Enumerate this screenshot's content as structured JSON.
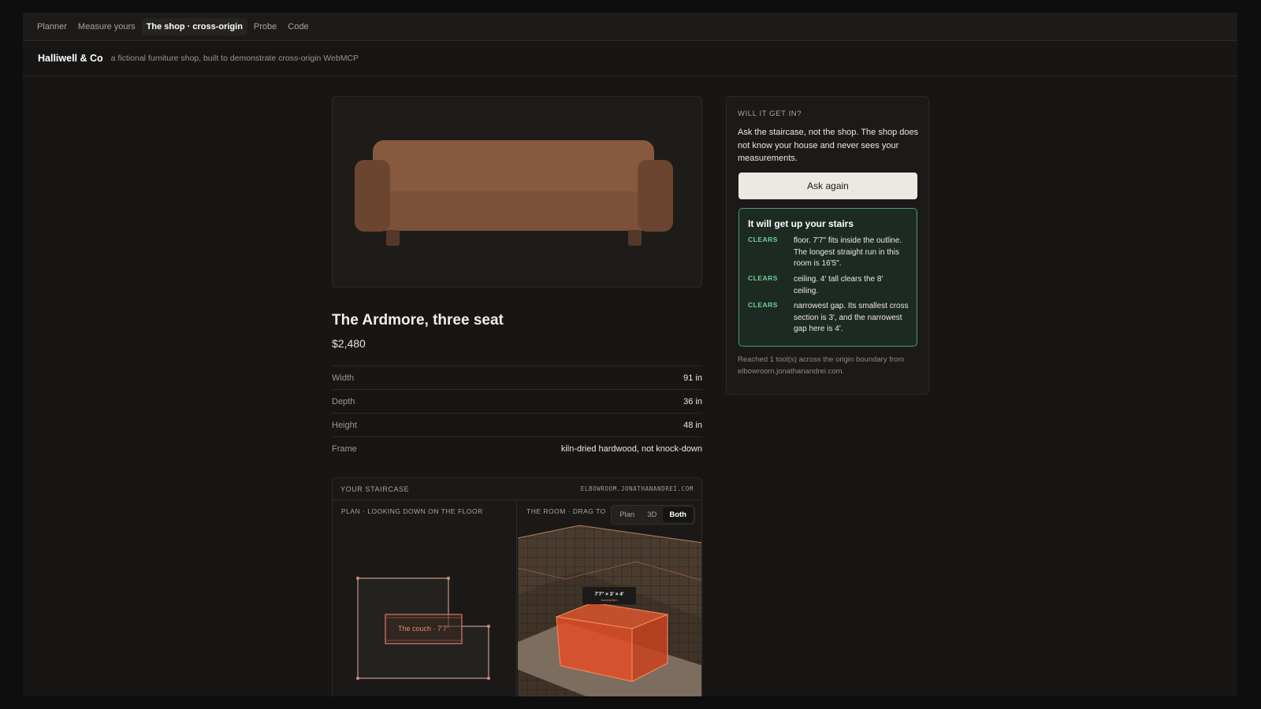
{
  "nav": {
    "tabs": [
      {
        "label": "Planner",
        "active": false
      },
      {
        "label": "Measure yours",
        "active": false
      },
      {
        "label": "The shop · cross-origin",
        "active": true
      },
      {
        "label": "Probe",
        "active": false
      },
      {
        "label": "Code",
        "active": false
      }
    ]
  },
  "brand": {
    "name": "Halliwell & Co",
    "tagline": "a fictional furniture shop, built to demonstrate cross-origin WebMCP"
  },
  "product": {
    "name": "The Ardmore, three seat",
    "price": "$2,480",
    "specs": [
      {
        "label": "Width",
        "value": "91 in"
      },
      {
        "label": "Depth",
        "value": "36 in"
      },
      {
        "label": "Height",
        "value": "48 in"
      },
      {
        "label": "Frame",
        "value": "kiln-dried hardwood, not knock-down"
      }
    ],
    "image_colors": {
      "body": "#7b5139",
      "back": "#875a40",
      "arm": "#6b452f",
      "leg": "#54382a"
    }
  },
  "staircase": {
    "title": "YOUR STAIRCASE",
    "domain": "ELBOWROOM.JONATHANANDREI.COM",
    "plan_label": "PLAN · LOOKING DOWN ON THE FLOOR",
    "room_label": "THE ROOM · DRAG TO",
    "plan_couch_label": "The couch · 7'7\"",
    "view_toggle": {
      "options": [
        "Plan",
        "3D",
        "Both"
      ],
      "selected": "Both"
    },
    "dimension_label": "7'7\" × 3' × 4'",
    "dimension_sublabel": "touching item"
  },
  "sidebar": {
    "heading": "WILL IT GET IN?",
    "body": "Ask the staircase, not the shop. The shop does not know your house and never sees your measurements.",
    "ask_button": "Ask again",
    "result": {
      "title": "It will get up your stairs",
      "checks": [
        {
          "status": "CLEARS",
          "text": "floor. 7'7\" fits inside the outline. The longest straight run in this room is 16'5\"."
        },
        {
          "status": "CLEARS",
          "text": "ceiling. 4' tall clears the 8' ceiling."
        },
        {
          "status": "CLEARS",
          "text": "narrowest gap. Its smallest cross section is 3', and the narrowest gap here is 4'."
        }
      ]
    },
    "footer": "Reached 1 tool(s) across the origin boundary from elbowroom.jonathanandrei.com."
  },
  "colors": {
    "accent_green": "#6fcf97",
    "couch_orange": "#e5603a",
    "background": "#171614"
  }
}
